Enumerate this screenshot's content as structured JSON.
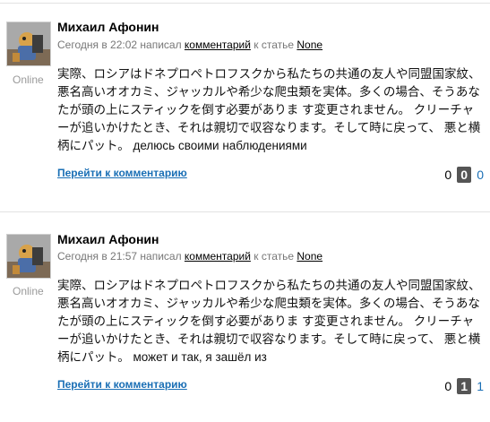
{
  "comments": [
    {
      "author": "Михаил Афонин",
      "status": "Online",
      "meta_prefix": "Сегодня в 22:02 написал",
      "meta_link": "комментарий",
      "meta_mid": "к статье",
      "meta_article": "None",
      "text": "実際、ロシアはドネプロペトロフスクから私たちの共通の友人や同盟国家紋、悪名高いオオカミ、ジャッカルや希少な爬虫類を実体。多くの場合、そうあなたが頭の上にスティックを倒す必要がありま す変更されません。 クリーチャーが追いかけたとき、それは親切で収容なります。そして時に戻って、 悪と横柄にパット。 делюсь своими наблюдениями",
      "goto_label": "Перейти к комментарию",
      "votes_minus": "0",
      "votes_total": "0",
      "votes_plus": "0"
    },
    {
      "author": "Михаил Афонин",
      "status": "Online",
      "meta_prefix": "Сегодня в 21:57 написал",
      "meta_link": "комментарий",
      "meta_mid": "к статье",
      "meta_article": "None",
      "text": "実際、ロシアはドネプロペトロフスクから私たちの共通の友人や同盟国家紋、悪名高いオオカミ、ジャッカルや希少な爬虫類を実体。多くの場合、そうあなたが頭の上にスティックを倒す必要がありま す変更されません。 クリーチャーが追いかけたとき、それは親切で収容なります。そして時に戻って、 悪と横柄にパット。 может и так, я зашёл из",
      "goto_label": "Перейти к комментарию",
      "votes_minus": "0",
      "votes_total": "1",
      "votes_plus": "1"
    }
  ]
}
